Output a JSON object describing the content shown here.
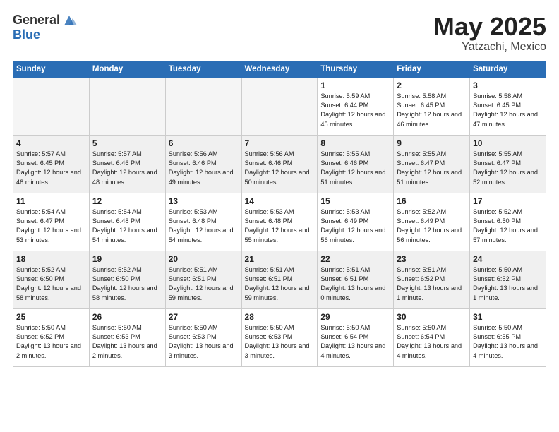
{
  "header": {
    "logo_general": "General",
    "logo_blue": "Blue",
    "title": "May 2025",
    "location": "Yatzachi, Mexico"
  },
  "weekdays": [
    "Sunday",
    "Monday",
    "Tuesday",
    "Wednesday",
    "Thursday",
    "Friday",
    "Saturday"
  ],
  "weeks": [
    [
      {
        "day": "",
        "empty": true
      },
      {
        "day": "",
        "empty": true
      },
      {
        "day": "",
        "empty": true
      },
      {
        "day": "",
        "empty": true
      },
      {
        "day": "1",
        "sunrise": "5:59 AM",
        "sunset": "6:44 PM",
        "daylight": "12 hours and 45 minutes."
      },
      {
        "day": "2",
        "sunrise": "5:58 AM",
        "sunset": "6:45 PM",
        "daylight": "12 hours and 46 minutes."
      },
      {
        "day": "3",
        "sunrise": "5:58 AM",
        "sunset": "6:45 PM",
        "daylight": "12 hours and 47 minutes."
      }
    ],
    [
      {
        "day": "4",
        "sunrise": "5:57 AM",
        "sunset": "6:45 PM",
        "daylight": "12 hours and 48 minutes."
      },
      {
        "day": "5",
        "sunrise": "5:57 AM",
        "sunset": "6:46 PM",
        "daylight": "12 hours and 48 minutes."
      },
      {
        "day": "6",
        "sunrise": "5:56 AM",
        "sunset": "6:46 PM",
        "daylight": "12 hours and 49 minutes."
      },
      {
        "day": "7",
        "sunrise": "5:56 AM",
        "sunset": "6:46 PM",
        "daylight": "12 hours and 50 minutes."
      },
      {
        "day": "8",
        "sunrise": "5:55 AM",
        "sunset": "6:46 PM",
        "daylight": "12 hours and 51 minutes."
      },
      {
        "day": "9",
        "sunrise": "5:55 AM",
        "sunset": "6:47 PM",
        "daylight": "12 hours and 51 minutes."
      },
      {
        "day": "10",
        "sunrise": "5:55 AM",
        "sunset": "6:47 PM",
        "daylight": "12 hours and 52 minutes."
      }
    ],
    [
      {
        "day": "11",
        "sunrise": "5:54 AM",
        "sunset": "6:47 PM",
        "daylight": "12 hours and 53 minutes."
      },
      {
        "day": "12",
        "sunrise": "5:54 AM",
        "sunset": "6:48 PM",
        "daylight": "12 hours and 54 minutes."
      },
      {
        "day": "13",
        "sunrise": "5:53 AM",
        "sunset": "6:48 PM",
        "daylight": "12 hours and 54 minutes."
      },
      {
        "day": "14",
        "sunrise": "5:53 AM",
        "sunset": "6:48 PM",
        "daylight": "12 hours and 55 minutes."
      },
      {
        "day": "15",
        "sunrise": "5:53 AM",
        "sunset": "6:49 PM",
        "daylight": "12 hours and 56 minutes."
      },
      {
        "day": "16",
        "sunrise": "5:52 AM",
        "sunset": "6:49 PM",
        "daylight": "12 hours and 56 minutes."
      },
      {
        "day": "17",
        "sunrise": "5:52 AM",
        "sunset": "6:50 PM",
        "daylight": "12 hours and 57 minutes."
      }
    ],
    [
      {
        "day": "18",
        "sunrise": "5:52 AM",
        "sunset": "6:50 PM",
        "daylight": "12 hours and 58 minutes."
      },
      {
        "day": "19",
        "sunrise": "5:52 AM",
        "sunset": "6:50 PM",
        "daylight": "12 hours and 58 minutes."
      },
      {
        "day": "20",
        "sunrise": "5:51 AM",
        "sunset": "6:51 PM",
        "daylight": "12 hours and 59 minutes."
      },
      {
        "day": "21",
        "sunrise": "5:51 AM",
        "sunset": "6:51 PM",
        "daylight": "12 hours and 59 minutes."
      },
      {
        "day": "22",
        "sunrise": "5:51 AM",
        "sunset": "6:51 PM",
        "daylight": "13 hours and 0 minutes."
      },
      {
        "day": "23",
        "sunrise": "5:51 AM",
        "sunset": "6:52 PM",
        "daylight": "13 hours and 1 minute."
      },
      {
        "day": "24",
        "sunrise": "5:50 AM",
        "sunset": "6:52 PM",
        "daylight": "13 hours and 1 minute."
      }
    ],
    [
      {
        "day": "25",
        "sunrise": "5:50 AM",
        "sunset": "6:52 PM",
        "daylight": "13 hours and 2 minutes."
      },
      {
        "day": "26",
        "sunrise": "5:50 AM",
        "sunset": "6:53 PM",
        "daylight": "13 hours and 2 minutes."
      },
      {
        "day": "27",
        "sunrise": "5:50 AM",
        "sunset": "6:53 PM",
        "daylight": "13 hours and 3 minutes."
      },
      {
        "day": "28",
        "sunrise": "5:50 AM",
        "sunset": "6:53 PM",
        "daylight": "13 hours and 3 minutes."
      },
      {
        "day": "29",
        "sunrise": "5:50 AM",
        "sunset": "6:54 PM",
        "daylight": "13 hours and 4 minutes."
      },
      {
        "day": "30",
        "sunrise": "5:50 AM",
        "sunset": "6:54 PM",
        "daylight": "13 hours and 4 minutes."
      },
      {
        "day": "31",
        "sunrise": "5:50 AM",
        "sunset": "6:55 PM",
        "daylight": "13 hours and 4 minutes."
      }
    ]
  ]
}
